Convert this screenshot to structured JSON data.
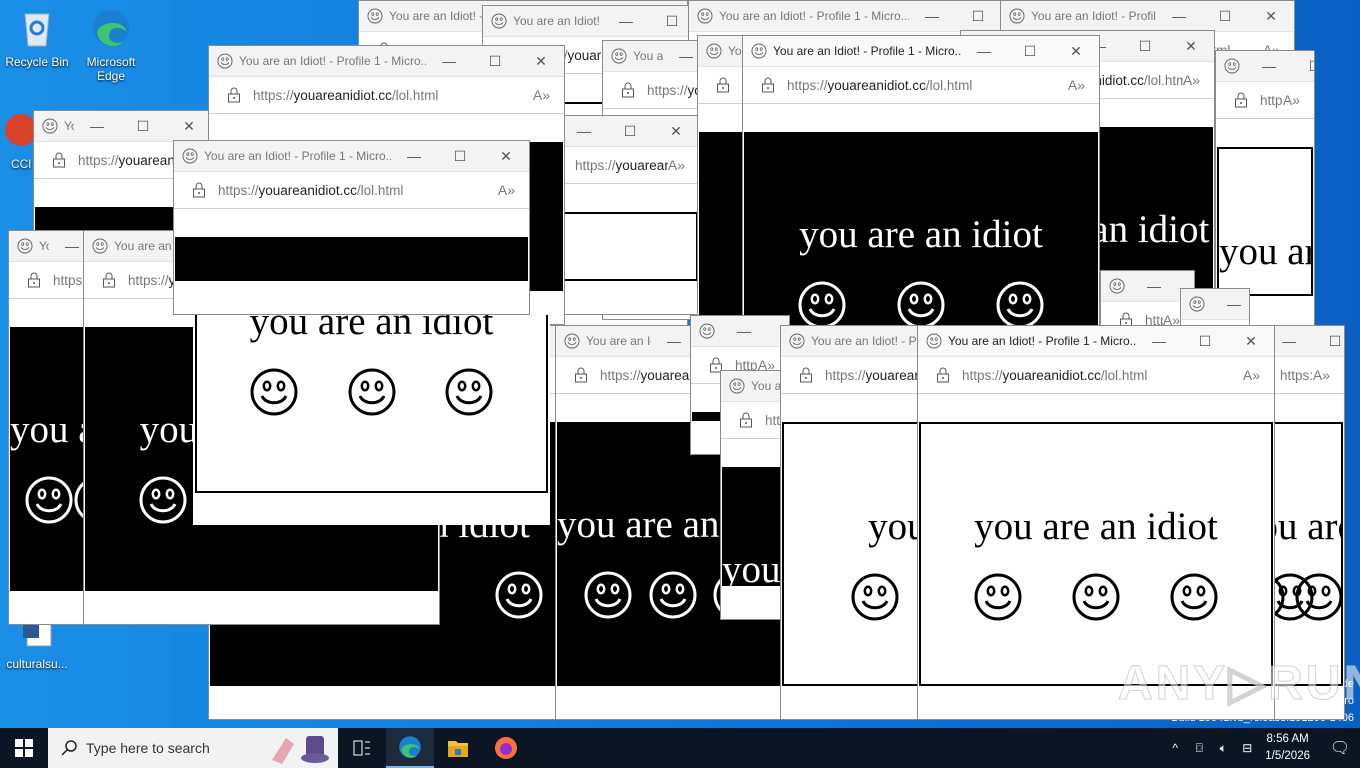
{
  "desktop": {
    "icons": [
      {
        "label": "Recycle Bin",
        "icon": "recycle-bin-icon"
      },
      {
        "label": "Microsoft Edge",
        "icon": "edge-icon"
      },
      {
        "label": "CCl",
        "icon": "ccleaner-icon"
      },
      {
        "label": "culturalsu...",
        "icon": "word-document-icon"
      }
    ],
    "build_lines": [
      "de",
      "ro",
      "Build 19041.vb_release.191206-1406"
    ],
    "watermark": "ANY▷RUN"
  },
  "browser_window": {
    "title": "You are an Idiot! - Profile 1 - Micro...",
    "url_scheme": "https://",
    "url_domain": "youareanidiot.cc",
    "url_path": "/lol.html",
    "read_aloud": "A»",
    "minimize": "—",
    "maximize": "☐",
    "close": "✕",
    "page_text": "you are an idiot",
    "smiley_count": 3
  },
  "taskbar": {
    "search_placeholder": "Type here to search",
    "apps": [
      "task-view",
      "microsoft-edge",
      "file-explorer",
      "firefox"
    ],
    "tray_chevron": "^",
    "time": "8:56 AM",
    "date": "1/5/2026"
  }
}
